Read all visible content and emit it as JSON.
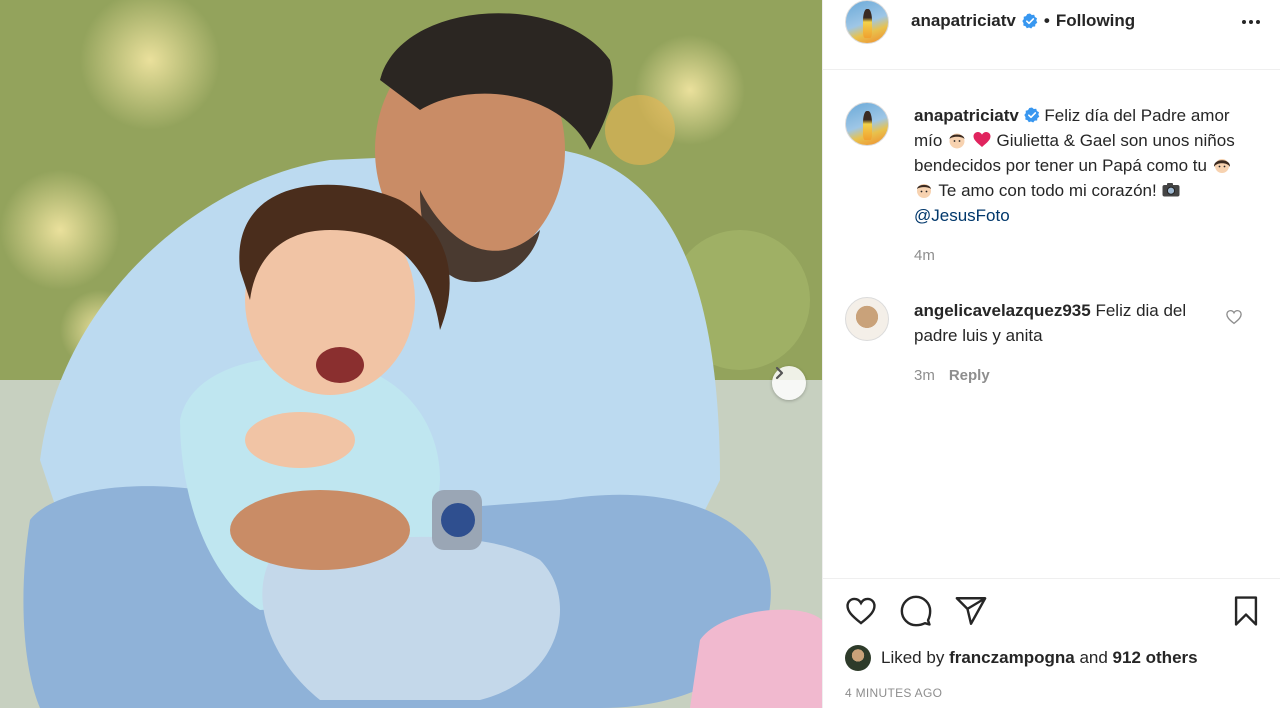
{
  "post": {
    "username": "anapatriciatv",
    "separator": "•",
    "follow_status": "Following",
    "caption": {
      "part1": "Feliz día del Padre amor mío",
      "part2": "Giulietta & Gael son unos niños bendecidos por tener un Papá como tu",
      "part3": "Te amo con todo mi corazón!",
      "mention": "@JesusFoto"
    },
    "caption_time": "4m"
  },
  "comment": {
    "username": "angelicavelazquez935",
    "text": "Feliz dia del padre luis y anita",
    "time": "3m",
    "reply_label": "Reply"
  },
  "likes": {
    "prefix": "Liked by",
    "user": "franczampogna",
    "middle": "and",
    "others": "912 others"
  },
  "timestamp": "4 MINUTES AGO",
  "icons": {
    "verified": "verified-badge-icon",
    "more": "more-options-icon",
    "next": "chevron-right-icon",
    "like": "heart-icon",
    "comment": "comment-icon",
    "share": "share-icon",
    "save": "bookmark-icon"
  },
  "colors": {
    "verified": "#3897f0",
    "link": "#00376b",
    "muted": "#8e8e8e",
    "heart_emoji": "#e0245e"
  }
}
